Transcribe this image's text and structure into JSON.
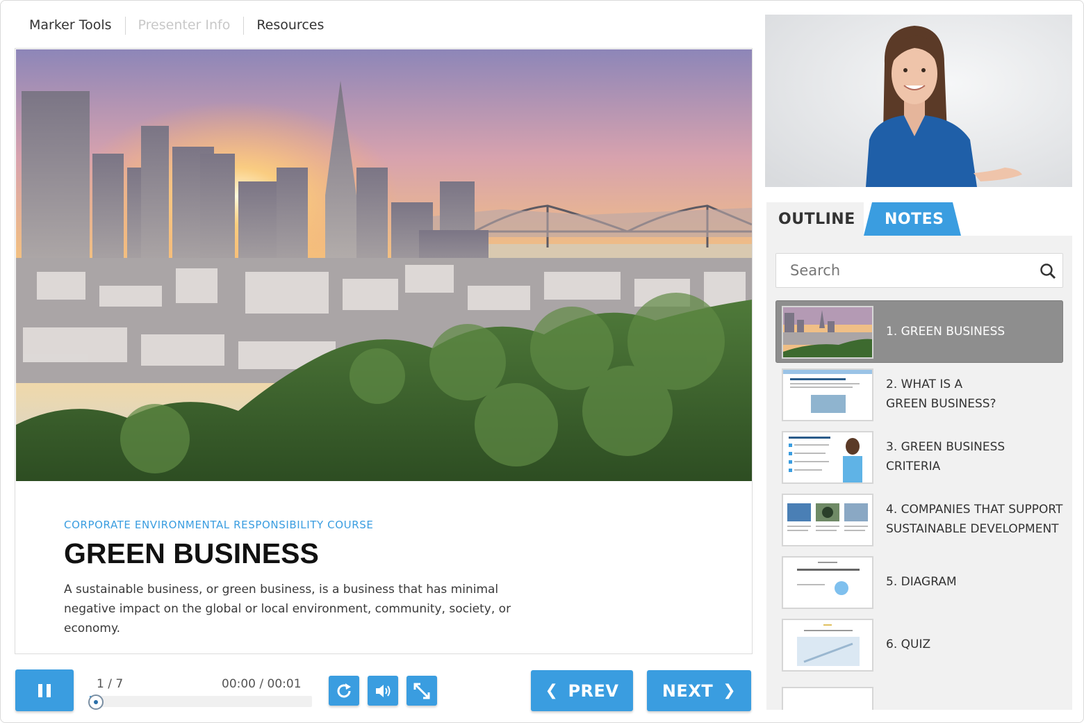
{
  "top_tabs": {
    "marker_tools": "Marker Tools",
    "presenter_info": "Presenter Info",
    "resources": "Resources"
  },
  "slide": {
    "subtitle": "CORPORATE ENVIRONMENTAL RESPONSIBILITY COURSE",
    "title": "GREEN BUSINESS",
    "description": "A sustainable business, or green business, is a business that has minimal negative impact on the global or local environment, community, society, or economy."
  },
  "player": {
    "slide_counter": "1 / 7",
    "time": "00:00 / 00:01",
    "progress_fraction": 0.02,
    "prev_label": "PREV",
    "next_label": "NEXT"
  },
  "sidebar": {
    "tabs": {
      "outline": "OUTLINE",
      "notes": "NOTES"
    },
    "search_placeholder": "Search",
    "items": [
      {
        "label": "1. GREEN BUSINESS"
      },
      {
        "label": "2. WHAT IS A\nGREEN BUSINESS?"
      },
      {
        "label": "3. GREEN BUSINESS\nCRITERIA"
      },
      {
        "label": "4. COMPANIES THAT SUPPORT\nSUSTAINABLE DEVELOPMENT"
      },
      {
        "label": "5. DIAGRAM"
      },
      {
        "label": "6. QUIZ"
      }
    ]
  },
  "colors": {
    "accent": "#3a9de0",
    "active_item": "#8e8e8e",
    "sidebar_bg": "#f1f1f1"
  },
  "icons": [
    "pause-icon",
    "replay-icon",
    "volume-icon",
    "fullscreen-icon",
    "chevron-left-icon",
    "chevron-right-icon",
    "search-icon"
  ]
}
